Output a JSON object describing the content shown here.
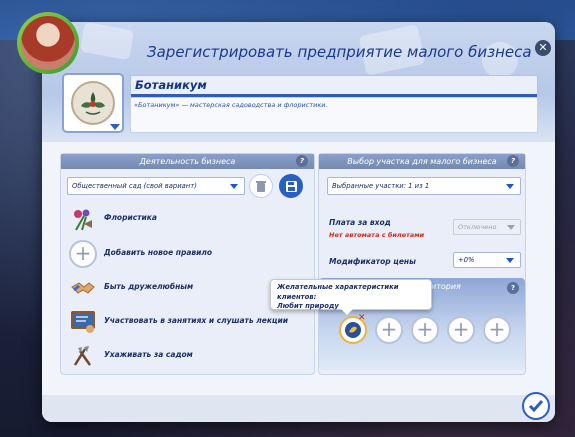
{
  "dialog": {
    "title": "Зарегистрировать предприятие малого бизнеса",
    "close_icon": "close-icon"
  },
  "business": {
    "name": "Ботаникум",
    "description": "«Ботаникум» — мастерская садоводства и флористики."
  },
  "activity_panel": {
    "header": "Деятельность бизнеса",
    "help": "?",
    "select_value": "Общественный сад (свой вариант)",
    "rules": [
      {
        "label": "Флористика",
        "icon": "floristry-icon"
      },
      {
        "label": "Добавить новое правило",
        "icon": "plus-icon"
      },
      {
        "label": "Быть дружелюбным",
        "icon": "handshake-icon"
      },
      {
        "label": "Участвовать в занятиях и слушать лекции",
        "icon": "lecture-icon"
      },
      {
        "label": "Ухаживать за садом",
        "icon": "garden-tools-icon"
      }
    ]
  },
  "lot_panel": {
    "header": "Выбор участка для малого бизнеса",
    "help": "?",
    "select_value": "Выбранные участки: 1 из 1",
    "entry_fee_label": "Плата за вход",
    "entry_fee_warning": "Нет автомата с билетами",
    "entry_fee_value": "Отключено",
    "price_modifier_label": "Модификатор цены",
    "price_modifier_value": "+0%"
  },
  "audience": {
    "title_partial": "итория",
    "help": "?"
  },
  "tooltip": {
    "line1": "Желательные характеристики клиентов:",
    "line2": "Любит природу"
  },
  "colors": {
    "accent": "#2a5ec1",
    "title_text": "#1b3a8c",
    "warning": "#d6281c",
    "panel_header": "#7d92bc"
  }
}
